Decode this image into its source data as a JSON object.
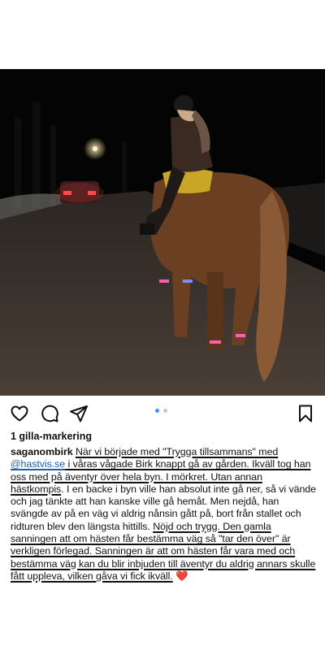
{
  "post": {
    "likes_text": "1 gilla-markering",
    "username": "saganombirk",
    "caption": {
      "part1": "När vi började med \"Trygga tillsammans\" med ",
      "mention": "@hastvis.se",
      "part2": " i våras vågade Birk knappt gå av gården. Ikväll tog han oss med på äventyr över hela byn. I mörkret. Utan annan hästkompis",
      "part3": ". I en backe i byn ville han absolut inte gå ner, så vi vände och jag tänkte att han kanske ville gå hemåt. Men nejdå, han svängde av på en väg vi aldrig nånsin gått på, bort från stallet och ridturen blev den längsta hittills. ",
      "part4": "Nöjd och trygg. Den gamla sanningen att om hästen får bestämma väg så \"tar den över\" är verkligen förlegad. Sanningen är att om hästen får vara med och bestämma väg kan du blir inbjuden till äventyr du aldrig annars skulle fått uppleva, vilken gåva vi fick ikväll.",
      "emoji": "❤️"
    },
    "carousel": {
      "count": 2,
      "active": 0
    }
  },
  "icons": {
    "like": "heart-outline-icon",
    "comment": "speech-bubble-icon",
    "share": "paper-plane-icon",
    "save": "bookmark-icon"
  },
  "colors": {
    "mention": "#1f5fa8",
    "dot_active": "#3897f0",
    "dot_inactive": "#c7c7c7"
  }
}
